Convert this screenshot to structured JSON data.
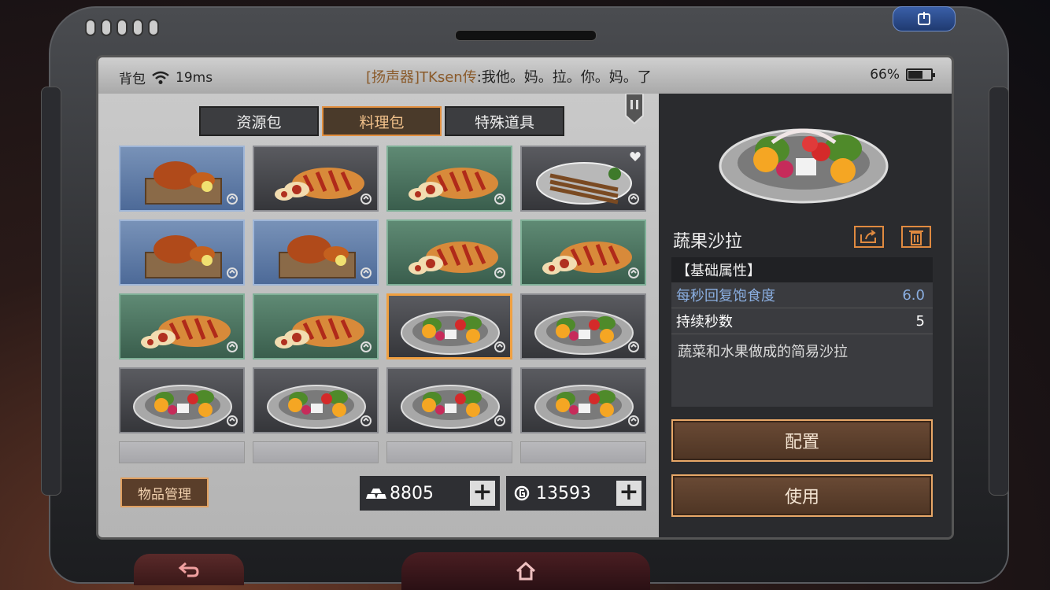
{
  "status": {
    "app_label": "背包",
    "ping": "19ms",
    "chat_channel": "[扬声器]",
    "chat_name": "TKsen",
    "chat_tag": "传",
    "chat_message": ":我他。妈。拉。你。妈。了",
    "battery_percent": "66%",
    "battery_level": 0.66
  },
  "tabs": [
    {
      "label": "资源包",
      "active": false
    },
    {
      "label": "料理包",
      "active": true
    },
    {
      "label": "特殊道具",
      "active": false
    }
  ],
  "inventory": {
    "slots": [
      {
        "item": "roast-chicken-box",
        "rarity": "blue",
        "icon": "roast-chicken-icon"
      },
      {
        "item": "sausage-bread",
        "rarity": "grey",
        "icon": "sausage-bread-icon"
      },
      {
        "item": "sausage-bread",
        "rarity": "green",
        "icon": "sausage-bread-icon"
      },
      {
        "item": "grilled-skewers",
        "rarity": "grey",
        "icon": "grilled-skewers-icon",
        "favorite": true
      },
      {
        "item": "roast-chicken-box",
        "rarity": "blue",
        "icon": "roast-chicken-icon"
      },
      {
        "item": "roast-chicken-box",
        "rarity": "blue",
        "icon": "roast-chicken-icon"
      },
      {
        "item": "sausage-bread",
        "rarity": "green",
        "icon": "sausage-bread-icon"
      },
      {
        "item": "sausage-bread",
        "rarity": "green",
        "icon": "sausage-bread-icon"
      },
      {
        "item": "sausage-bread",
        "rarity": "green",
        "icon": "sausage-bread-icon"
      },
      {
        "item": "sausage-bread",
        "rarity": "green",
        "icon": "sausage-bread-icon"
      },
      {
        "item": "fruit-salad",
        "rarity": "grey",
        "icon": "fruit-salad-icon",
        "selected": true
      },
      {
        "item": "fruit-salad",
        "rarity": "grey",
        "icon": "fruit-salad-icon"
      },
      {
        "item": "fruit-salad",
        "rarity": "grey",
        "icon": "fruit-salad-icon"
      },
      {
        "item": "fruit-salad",
        "rarity": "grey",
        "icon": "fruit-salad-icon"
      },
      {
        "item": "fruit-salad",
        "rarity": "grey",
        "icon": "fruit-salad-icon"
      },
      {
        "item": "fruit-salad",
        "rarity": "grey",
        "icon": "fruit-salad-icon"
      }
    ],
    "manage_label": "物品管理",
    "silver_amount": "8805",
    "gold_amount": "13593"
  },
  "detail": {
    "title": "蔬果沙拉",
    "attr_header": "【基础属性】",
    "attrs": [
      {
        "name": "每秒回复饱食度",
        "value": "6.0"
      },
      {
        "name": "持续秒数",
        "value": "5"
      }
    ],
    "description": "蔬菜和水果做成的简易沙拉",
    "configure_label": "配置",
    "use_label": "使用"
  },
  "colors": {
    "accent": "#e8a868",
    "blue_rarity": "#4d6a98",
    "green_rarity": "#3a5e4d",
    "grey_rarity": "#35363a"
  }
}
